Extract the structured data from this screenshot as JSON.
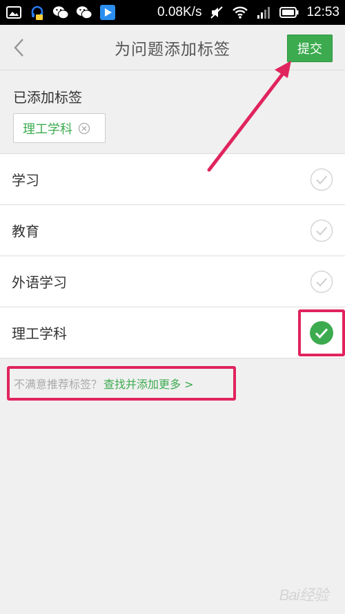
{
  "status_bar": {
    "speed": "0.08K/s",
    "time": "12:53",
    "icons": [
      "gallery-icon",
      "headset-app-icon",
      "wechat-icon",
      "wechat-icon",
      "play-store-icon",
      "mute-icon",
      "wifi-icon",
      "signal-icon",
      "battery-icon"
    ]
  },
  "header": {
    "title": "为问题添加标签",
    "submit_label": "提交"
  },
  "added_tags": {
    "title": "已添加标签",
    "tags": [
      "理工学科"
    ]
  },
  "tag_list": [
    {
      "label": "学习",
      "checked": false
    },
    {
      "label": "教育",
      "checked": false
    },
    {
      "label": "外语学习",
      "checked": false
    },
    {
      "label": "理工学科",
      "checked": true
    }
  ],
  "more": {
    "question": "不满意推荐标签？",
    "link": "查找并添加更多 >"
  },
  "watermark": "Bai经验",
  "colors": {
    "accent": "#3cab4f",
    "highlight": "#e0245e"
  }
}
